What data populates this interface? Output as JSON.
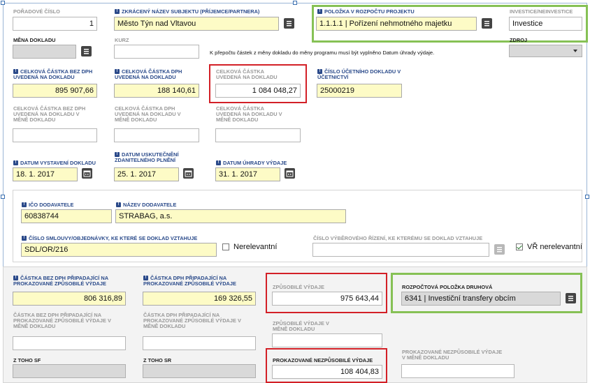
{
  "row1": {
    "poradove_cislo": {
      "label": "POŘADOVÉ ČÍSLO",
      "value": "1"
    },
    "zkraceny_nazev": {
      "label": "ZKRÁCENÝ NÁZEV SUBJEKTU (PŘÍJEMCE/PARTNERA)",
      "value": "Město Týn nad Vltavou"
    },
    "polozka_rozpoctu": {
      "label": "POLOŽKA V ROZPOČTU PROJEKTU",
      "value": "1.1.1.1 | Pořízení nehmotného majetku"
    },
    "investice": {
      "label": "INVESTICE/NEINVESTICE",
      "value": "Investice"
    }
  },
  "row2": {
    "mena_dokladu": {
      "label": "MĚNA DOKLADU",
      "value": ""
    },
    "kurz": {
      "label": "KURZ",
      "value": ""
    },
    "note": "K přepočtu částek z měny dokladu do měny programu musí být vyplněno Datum úhrady výdaje.",
    "zdroj": {
      "label": "ZDROJ",
      "value": ""
    }
  },
  "row3": {
    "bez_dph": {
      "label": "CELKOVÁ ČÁSTKA BEZ DPH UVEDENÁ NA DOKLADU",
      "value": "895 907,66"
    },
    "dph": {
      "label": "CELKOVÁ ČÁSTKA DPH UVEDENÁ NA DOKLADU",
      "value": "188 140,61"
    },
    "celkova": {
      "label": "CELKOVÁ ČÁSTKA UVEDENÁ NA DOKLADU",
      "value": "1 084 048,27"
    },
    "cislo_ucetniho": {
      "label": "ČÍSLO ÚČETNÍHO DOKLADU V ÚČETNICTVÍ",
      "value": "25000219"
    }
  },
  "row4": {
    "bez_dph_mena": {
      "label": "CELKOVÁ ČÁSTKA BEZ DPH UVEDENÁ NA DOKLADU V MĚNĚ DOKLADU",
      "value": ""
    },
    "dph_mena": {
      "label": "CELKOVÁ ČÁSTKA DPH UVEDENÁ NA DOKLADU V MĚNĚ DOKLADU",
      "value": ""
    },
    "celkova_mena": {
      "label": "CELKOVÁ ČÁSTKA UVEDENÁ NA DOKLADU V MĚNĚ DOKLADU",
      "value": ""
    }
  },
  "row5": {
    "datum_vystaveni": {
      "label": "DATUM VYSTAVENÍ DOKLADU",
      "value": "18. 1. 2017"
    },
    "datum_uskutecneni": {
      "label": "DATUM USKUTEČNĚNÍ ZDANITELNÉHO PLNĚNÍ",
      "value": "25. 1. 2017"
    },
    "datum_uhrady": {
      "label": "DATUM ÚHRADY VÝDAJE",
      "value": "31. 1. 2017"
    }
  },
  "dodavatel": {
    "ico": {
      "label": "IČO DODAVATELE",
      "value": "60838744"
    },
    "nazev": {
      "label": "NÁZEV DODAVATELE",
      "value": "STRABAG, a.s."
    },
    "cislo_smlouvy": {
      "label": "ČÍSLO SMLOUVY/OBJEDNÁVKY, KE KTERÉ SE DOKLAD VZTAHUJE",
      "value": "SDL/OR/216"
    },
    "nerelevantni": "Nerelevantní",
    "cislo_vr": {
      "label": "ČÍSLO VÝBĚROVÉHO ŘÍZENÍ, KE KTERÉMU SE DOKLAD VZTAHUJE",
      "value": ""
    },
    "vr_nerelevantni": "VŘ nerelevantní"
  },
  "castky": {
    "bez_dph_zpusobile": {
      "label": "ČÁSTKA BEZ DPH PŘIPADAJÍCÍ NA PROKAZOVANÉ ZPŮSOBILÉ VÝDAJE",
      "value": "806 316,89"
    },
    "dph_zpusobile": {
      "label": "ČÁSTKA DPH PŘIPADAJÍCÍ NA PROKAZOVANÉ ZPŮSOBILÉ VÝDAJE",
      "value": "169 326,55"
    },
    "zpusobile_vydaje": {
      "label": "ZPŮSOBILÉ VÝDAJE",
      "value": "975 643,44"
    },
    "rozpoctova_polozka": {
      "label": "ROZPOČTOVÁ POLOŽKA DRUHOVÁ",
      "value": "6341 | Investiční transfery obcím"
    },
    "bez_dph_mena": {
      "label": "ČÁSTKA BEZ DPH PŘIPADAJÍCÍ NA PROKAZOVANÉ ZPŮSOBILÉ VÝDAJE V MĚNĚ DOKLADU",
      "value": ""
    },
    "dph_mena": {
      "label": "ČÁSTKA DPH PŘIPADAJÍCÍ NA PROKAZOVANÉ ZPŮSOBILÉ VÝDAJE V MĚNĚ DOKLADU",
      "value": ""
    },
    "zpusobile_mena": {
      "label": "ZPŮSOBILÉ VÝDAJE V MĚNĚ DOKLADU",
      "value": ""
    },
    "z_toho_sf": {
      "label": "Z TOHO SF",
      "value": ""
    },
    "z_toho_sr": {
      "label": "Z TOHO SR",
      "value": ""
    },
    "nezpusobile": {
      "label": "PROKAZOVANÉ NEZPŮSOBILÉ VÝDAJE",
      "value": "108 404,83"
    },
    "nezpusobile_mena": {
      "label": "PROKAZOVANÉ NEZPŮSOBILÉ VÝDAJE V MĚNĚ DOKLADU",
      "value": ""
    }
  },
  "colors": {
    "required_field": "#fdfbc6",
    "highlight_red": "#d32027",
    "highlight_green": "#86c155",
    "label_blue": "#2a4a8a"
  }
}
